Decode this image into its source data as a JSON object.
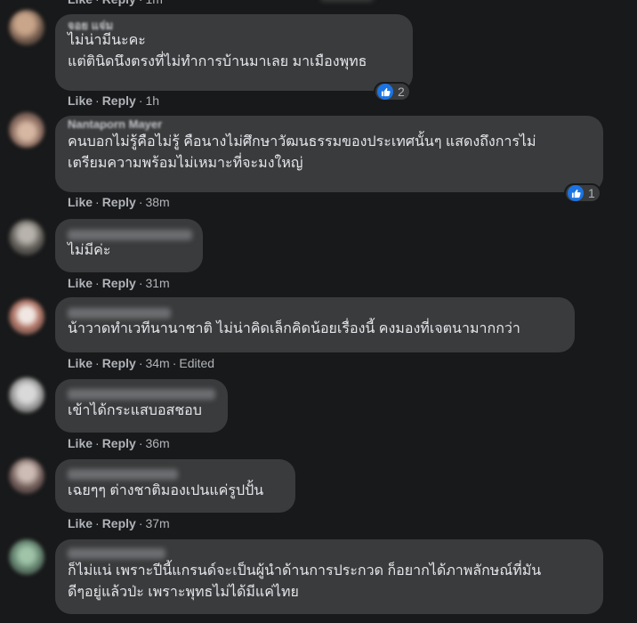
{
  "actions": {
    "like_label": "Like",
    "reply_label": "Reply",
    "separator": "·"
  },
  "colors": {
    "background": "#18191a",
    "bubble": "#3a3b3c",
    "text": "#e4e6eb",
    "secondary_text": "#b0b3b8",
    "like_blue": "#1b74e4"
  },
  "top_fragment": {
    "time": "1m"
  },
  "comments": [
    {
      "author": "จอย แจ่ม",
      "lines": [
        "ไม่น่ามีนะคะ",
        "แต่ตินิดนึงตรงที่ไม่ทำการบ้านมาเลย มาเมืองพุทธ"
      ],
      "time": "1h",
      "edited": "",
      "reaction_icon": "like-icon",
      "reaction_count": "2"
    },
    {
      "author": "Nantaporn Mayer",
      "lines": [
        "คนบอกไม่รู้คือไม่รู้ คือนางไม่ศึกษาวัฒนธรรมของประเทศนั้นๆ แสดงถึงการไม่",
        "เตรียมความพร้อมไม่เหมาะที่จะมงใหญ่"
      ],
      "time": "38m",
      "edited": "",
      "reaction_icon": "like-icon",
      "reaction_count": "1"
    },
    {
      "author": "",
      "lines": [
        "ไม่มีค่ะ"
      ],
      "time": "31m",
      "edited": ""
    },
    {
      "author": "",
      "lines": [
        "น้าวาดทำเวทีนานาชาติ ไม่น่าคิดเล็กคิดน้อยเรื่องนี้ คงมองที่เจตนามากกว่า"
      ],
      "time": "34m",
      "edited": "Edited"
    },
    {
      "author": "",
      "lines": [
        "เข้าได้กระแสบอสชอบ"
      ],
      "time": "36m",
      "edited": ""
    },
    {
      "author": "",
      "lines": [
        "เฉยๆๆ ต่างชาติมองเปนแค่รูปปั้น"
      ],
      "time": "37m",
      "edited": ""
    },
    {
      "author": "",
      "lines": [
        "ก็ไม่แน่ เพราะปีนี้แกรนด์จะเป็นผู้นำด้านการประกวด ก็อยากได้ภาพลักษณ์ที่มัน",
        "ดีๆอยู่แล้วป่ะ เพราะพุทธไม่ได้มีแค่ไทย"
      ],
      "time": "",
      "edited": ""
    }
  ]
}
